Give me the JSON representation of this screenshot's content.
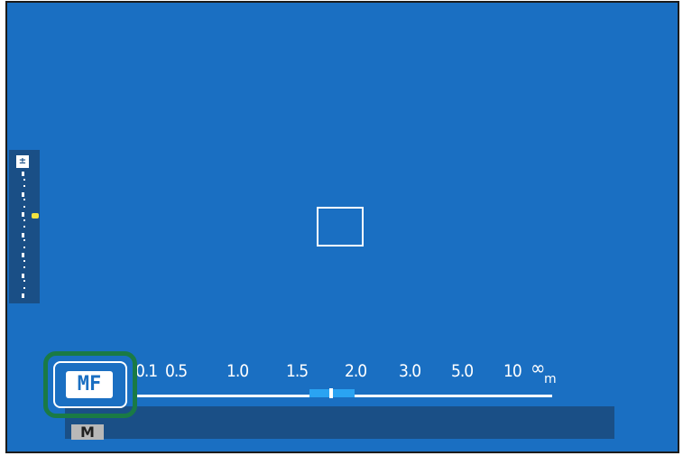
{
  "viewfinder": {
    "exposure_icon": "±",
    "focus_mode": "MF",
    "shooting_mode": "M",
    "distance_scale": {
      "labels": [
        "0.1",
        "0.5",
        "1.0",
        "1.5",
        "2.0",
        "3.0",
        "5.0",
        "10",
        "∞"
      ],
      "unit": "m"
    }
  },
  "colors": {
    "background": "#1a6fc2",
    "panel": "#1a4f86",
    "highlight_ring": "#1a7a45",
    "range_bar": "#2aa3f2",
    "exposure_indicator": "#f1e340"
  }
}
